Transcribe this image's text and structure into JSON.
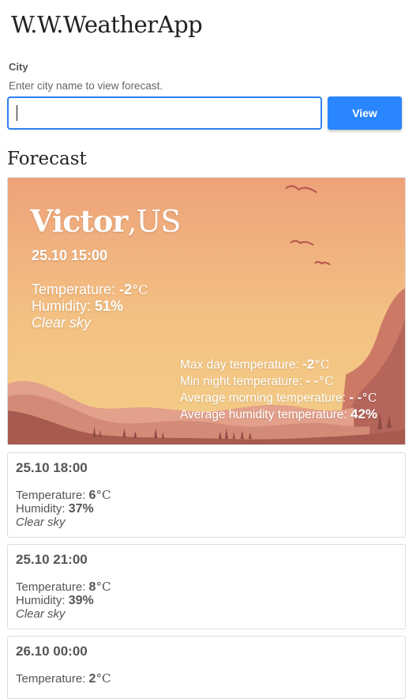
{
  "app": {
    "title": "W.W.WeatherApp"
  },
  "search": {
    "label": "City",
    "help": "Enter city name to view forecast.",
    "value": "",
    "button_label": "View"
  },
  "forecast": {
    "heading": "Forecast",
    "current": {
      "city": "Victor",
      "country": ",US",
      "datetime": "25.10 15:00",
      "temperature_label": "Temperature:",
      "temperature": "-2",
      "unit": "°C",
      "humidity_label": "Humidity:",
      "humidity": "51%",
      "condition": "Clear sky",
      "max_day_label": "Max day temperature:",
      "max_day": "-2",
      "min_night_label": "Min night temperature:",
      "min_night": "- -",
      "avg_morning_label": "Average morning temperature:",
      "avg_morning": "- -",
      "avg_humidity_label": "Average humidity temperature:",
      "avg_humidity": "42%"
    },
    "cards": [
      {
        "datetime": "25.10 18:00",
        "temperature_label": "Temperature:",
        "temperature": "6",
        "unit": "°C",
        "humidity_label": "Humidity:",
        "humidity": "37%",
        "condition": "Clear sky"
      },
      {
        "datetime": "25.10 21:00",
        "temperature_label": "Temperature:",
        "temperature": "8",
        "unit": "°C",
        "humidity_label": "Humidity:",
        "humidity": "39%",
        "condition": "Clear sky"
      },
      {
        "datetime": "26.10 00:00",
        "temperature_label": "Temperature:",
        "temperature": "2",
        "unit": "°C"
      }
    ]
  },
  "colors": {
    "accent": "#2a86ff",
    "sky_top": "#eea27a",
    "sky_bottom": "#f2cc82"
  }
}
